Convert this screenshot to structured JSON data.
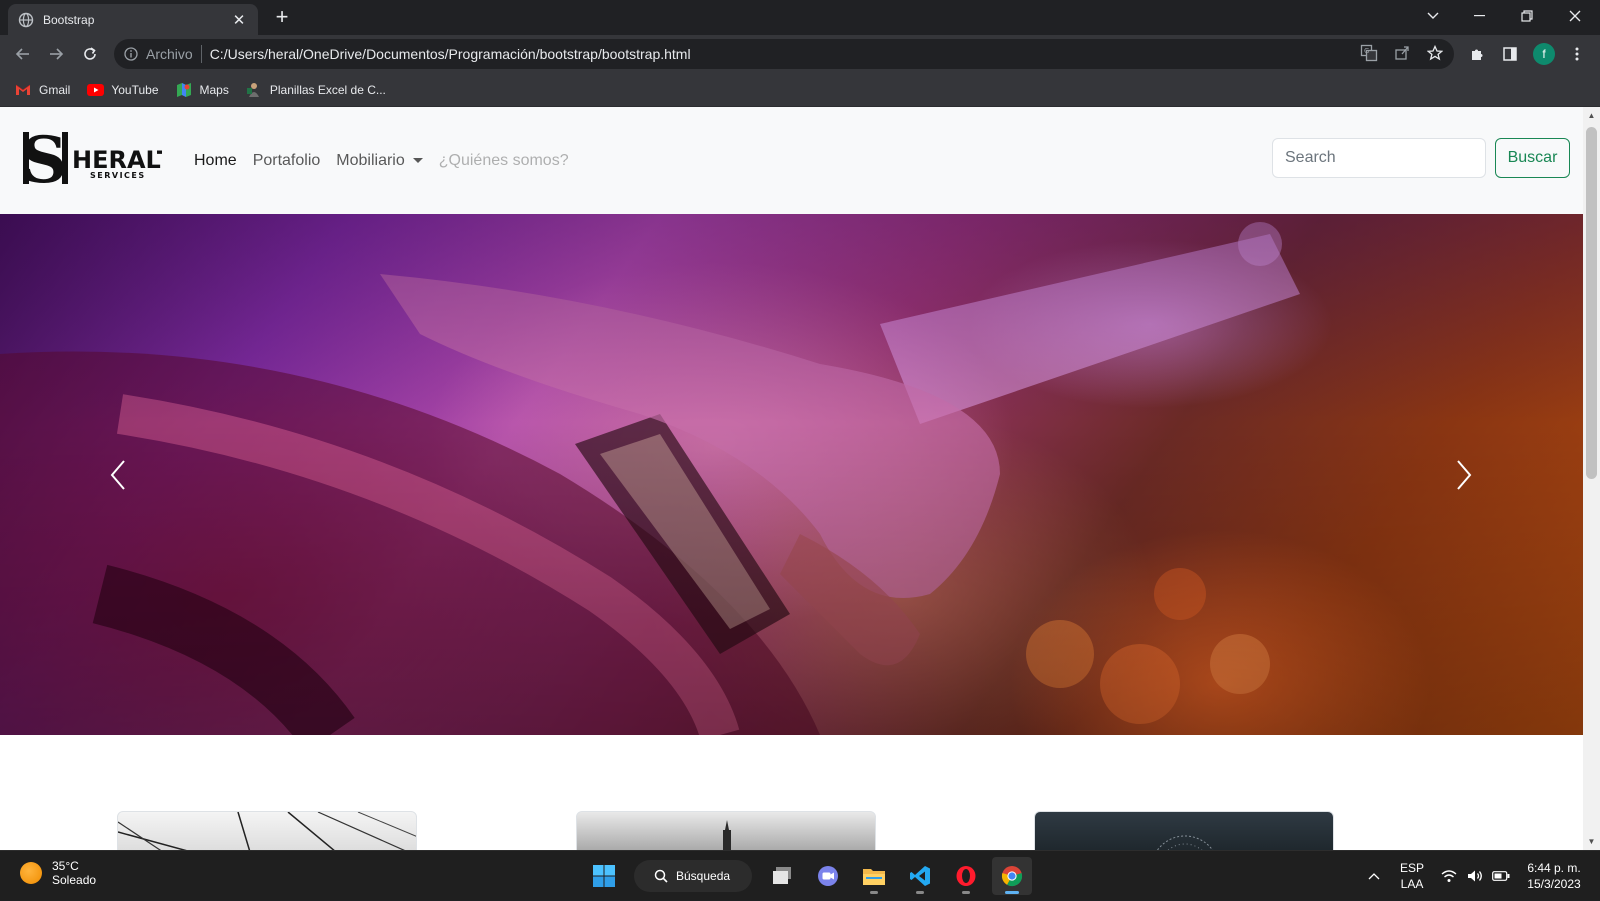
{
  "browser": {
    "tab": {
      "title": "Bootstrap"
    },
    "address": {
      "scheme": "Archivo",
      "url": "C:/Users/heral/OneDrive/Documentos/Programación/bootstrap/bootstrap.html"
    },
    "profile_initial": "f",
    "bookmarks": [
      {
        "label": "Gmail",
        "icon": "gmail-icon"
      },
      {
        "label": "YouTube",
        "icon": "youtube-icon"
      },
      {
        "label": "Maps",
        "icon": "maps-icon"
      },
      {
        "label": "Planillas Excel de C...",
        "icon": "excel-templates-icon"
      }
    ]
  },
  "page": {
    "brand": {
      "letter": "S",
      "name": "HERALT",
      "tagline": "SERVICES"
    },
    "nav": {
      "items": [
        {
          "label": "Home"
        },
        {
          "label": "Portafolio"
        },
        {
          "label": "Mobiliario"
        },
        {
          "label": "¿Quiénes somos?"
        }
      ]
    },
    "search": {
      "placeholder": "Search",
      "button_label": "Buscar"
    },
    "carousel": {
      "active_slide": 1,
      "slide_count": 3
    }
  },
  "taskbar": {
    "weather": {
      "temp": "35°C",
      "condition": "Soleado"
    },
    "search_label": "Búsqueda",
    "language": {
      "lang": "ESP",
      "layout": "LAA"
    },
    "clock": {
      "time": "6:44 p. m.",
      "date": "15/3/2023"
    }
  },
  "colors": {
    "success": "#198754",
    "chrome_dark": "#202124",
    "chrome_toolbar": "#35363a"
  }
}
